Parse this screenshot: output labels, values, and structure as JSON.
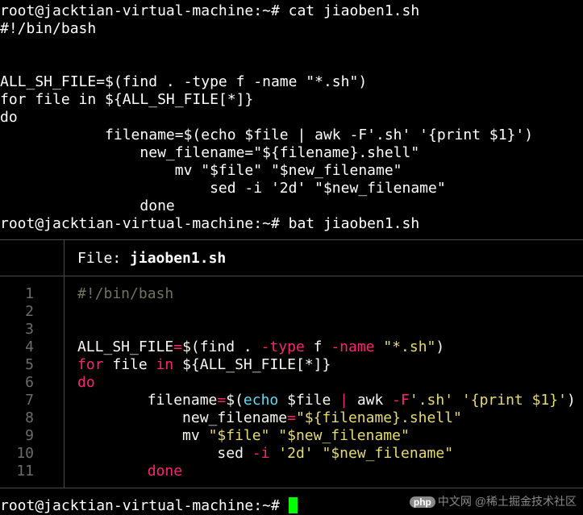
{
  "colors": {
    "keyword": "#f92672",
    "string": "#e6db74",
    "builtin": "#66d9ef",
    "comment": "#75715e",
    "plain": "#f8f8f2",
    "cursor": "#00ff00"
  },
  "cat_section": {
    "prompt_command": "root@jacktian-virtual-machine:~# cat jiaoben1.sh",
    "output": [
      "#!/bin/bash",
      "",
      "",
      "ALL_SH_FILE=$(find . -type f -name \"*.sh\")",
      "for file in ${ALL_SH_FILE[*]}",
      "do",
      "            filename=$(echo $file | awk -F'.sh' '{print $1}')",
      "                new_filename=\"${filename}.shell\"",
      "                    mv \"$file\" \"$new_filename\"",
      "                        sed -i '2d' \"$new_filename\"",
      "                done"
    ]
  },
  "bat_section": {
    "prompt_command": "root@jacktian-virtual-machine:~# bat jiaoben1.sh",
    "header_label": "File: ",
    "header_filename": "jiaoben1.sh",
    "line_numbers": [
      "1",
      "2",
      "3",
      "4",
      "5",
      "6",
      "7",
      "8",
      "9",
      "10",
      "11"
    ]
  },
  "final_prompt": "root@jacktian-virtual-machine:~# ",
  "watermark": {
    "badge": "php",
    "text": "中文网",
    "site": "@稀土掘金技术社区"
  }
}
